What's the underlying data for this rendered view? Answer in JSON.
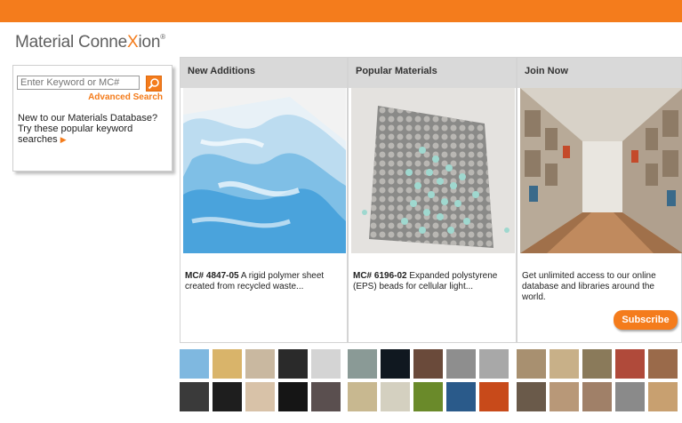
{
  "header": {
    "logo_prefix": "Material Conne",
    "logo_x": "X",
    "logo_suffix": "ion",
    "logo_tm": "®"
  },
  "search": {
    "placeholder": "Enter Keyword or MC#",
    "advanced_label": "Advanced Search",
    "promo_text": "New to our Materials Database? Try these popular keyword searches",
    "promo_arrow": "▶"
  },
  "columns": [
    {
      "title": "New Additions",
      "mc": "MC# 4847-05",
      "desc": " A rigid polymer sheet created from recycled waste..."
    },
    {
      "title": "Popular Materials",
      "mc": "MC# 6196-02",
      "desc": " Expanded polystyrene (EPS) beads for cellular light..."
    },
    {
      "title": "Join Now",
      "text": "Get unlimited access to our online database and libraries around the world.",
      "button": "Subscribe"
    }
  ],
  "colors": {
    "accent": "#f47c1c",
    "header_bg": "#d9d9d9"
  }
}
